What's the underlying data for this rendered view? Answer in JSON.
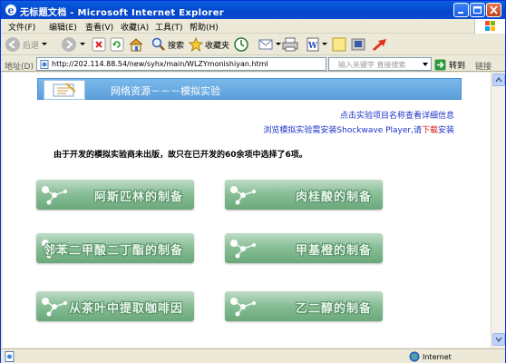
{
  "window": {
    "title": "无标题文档 - Microsoft Internet Explorer"
  },
  "menu": {
    "items": [
      "文件(F)",
      "编辑(E)",
      "查看(V)",
      "收藏(A)",
      "工具(T)",
      "帮助(H)"
    ]
  },
  "toolbar": {
    "back_label": "后退",
    "search_label": "搜索",
    "favorites_label": "收藏夹"
  },
  "address_bar": {
    "label": "地址(D)",
    "url": "http://202.114.88.54/new/syhx/main/WLZYmonishiyan.html",
    "search_placeholder": "输入关键字 直接搜索",
    "go_label": "转到",
    "links_label": "链接"
  },
  "page": {
    "header_title": "网络资源－－－模拟实验",
    "info_link": "点击实验项目名称查看详细信息",
    "install_prefix": "浏览模拟实验需安装Shockwave Player,请",
    "install_link": "下载",
    "install_suffix": "安装",
    "notice": "由于开发的模拟实验商未出版，故只在已开发的60余项中选择了6项。",
    "experiments": [
      "阿斯匹林的制备",
      "肉桂酸的制备",
      "邻苯二甲酸二丁酯的制备",
      "甲基橙的制备",
      "从茶叶中提取咖啡因",
      "乙二醇的制备"
    ]
  },
  "status_bar": {
    "zone": "Internet"
  },
  "colors": {
    "title_bar": "#0a5fe0",
    "header_panel": "#6aabe3",
    "button_green": "#8abf98",
    "link_blue": "#1e33c8",
    "download_red": "#e01010"
  }
}
